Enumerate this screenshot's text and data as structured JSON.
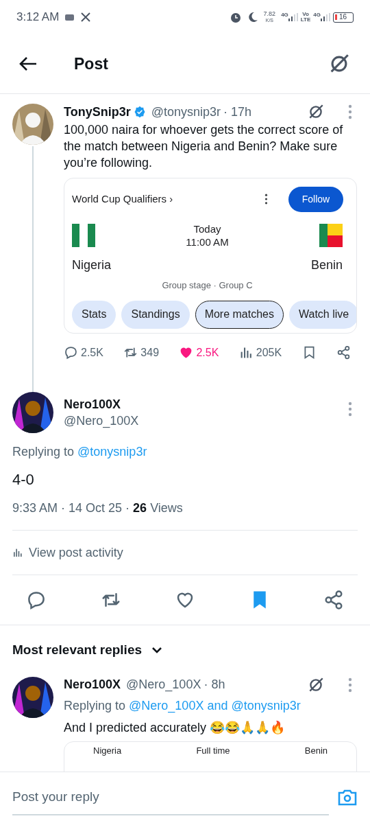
{
  "status_bar": {
    "time": "3:12 AM",
    "net_speed": "7.82",
    "net_unit": "K/S",
    "sim1": "4G",
    "volte_top": "Vo",
    "volte_bottom": "LTE",
    "sim2": "4G",
    "battery": "16"
  },
  "header": {
    "title": "Post"
  },
  "parent_post": {
    "name": "TonySnip3r",
    "verified": true,
    "handle": "@tonysnip3r",
    "time": "· 17h",
    "text": "100,000 naira for whoever gets the correct score of the match between Nigeria and Benin? Make sure you’re following.",
    "card": {
      "competition": "World Cup Qualifiers ›",
      "follow": "Follow",
      "day": "Today",
      "kickoff": "11:00 AM",
      "home": "Nigeria",
      "away": "Benin",
      "stage": "Group stage · Group C",
      "chips": [
        {
          "label": "Stats",
          "selected": false
        },
        {
          "label": "Standings",
          "selected": false
        },
        {
          "label": "More matches",
          "selected": true
        },
        {
          "label": "Watch live",
          "selected": false
        }
      ]
    },
    "actions": {
      "replies": "2.5K",
      "reposts": "349",
      "likes": "2.5K",
      "liked": true,
      "views": "205K"
    }
  },
  "main_post": {
    "name": "Nero100X",
    "handle": "@Nero_100X",
    "replying_label": "Replying to",
    "replying_to": "@tonysnip3r",
    "text": "4-0",
    "time": "9:33 AM · 14 Oct 25 · ",
    "views_count": "26",
    "views_label": " Views",
    "activity": "View post activity",
    "bookmarked": true
  },
  "replies_sort": "Most relevant replies",
  "reply": {
    "name": "Nero100X",
    "handle": "@Nero_100X",
    "time": "· 8h",
    "replying_label": "Replying to",
    "replying_to": "@Nero_100X and @tonysnip3r",
    "text": "And I predicted accurately 😂😂🙏🙏🔥",
    "card": {
      "home": "Nigeria",
      "status": "Full time",
      "away": "Benin"
    }
  },
  "composer": {
    "placeholder": "Post your reply"
  }
}
